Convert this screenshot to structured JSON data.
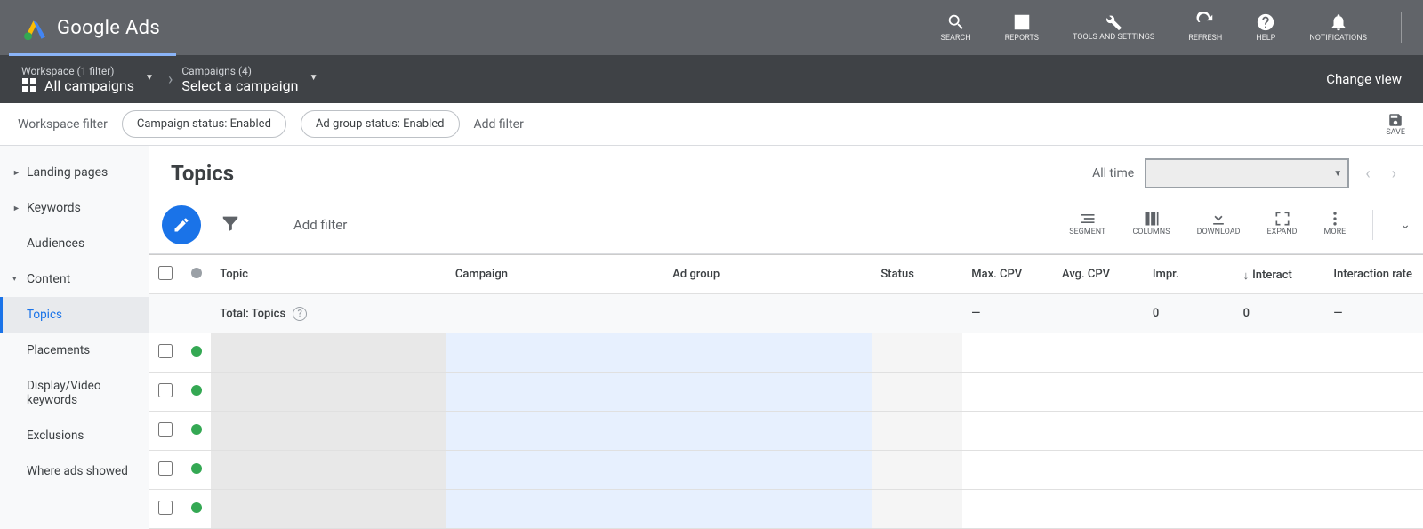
{
  "brand": "Google Ads",
  "topActions": [
    {
      "label": "SEARCH"
    },
    {
      "label": "REPORTS"
    },
    {
      "label": "TOOLS AND SETTINGS"
    },
    {
      "label": "REFRESH"
    },
    {
      "label": "HELP"
    },
    {
      "label": "NOTIFICATIONS"
    }
  ],
  "nav": {
    "workspace": {
      "small": "Workspace (1 filter)",
      "big": "All campaigns"
    },
    "campaigns": {
      "small": "Campaigns (4)",
      "big": "Select a campaign"
    },
    "changeView": "Change view"
  },
  "filterBar": {
    "title": "Workspace filter",
    "chips": [
      "Campaign status: Enabled",
      "Ad group status: Enabled"
    ],
    "addFilter": "Add filter",
    "save": "SAVE"
  },
  "sidebar": {
    "items": [
      {
        "label": "Landing pages",
        "caret": "►"
      },
      {
        "label": "Keywords",
        "caret": "►"
      },
      {
        "label": "Audiences",
        "caret": ""
      },
      {
        "label": "Content",
        "caret": "▾"
      }
    ],
    "subs": [
      {
        "label": "Topics",
        "active": true
      },
      {
        "label": "Placements"
      },
      {
        "label": "Display/Video keywords"
      },
      {
        "label": "Exclusions"
      },
      {
        "label": "Where ads showed"
      }
    ]
  },
  "page": {
    "title": "Topics",
    "allTime": "All time"
  },
  "toolbar": {
    "addFilter": "Add filter",
    "buttons": [
      "SEGMENT",
      "COLUMNS",
      "DOWNLOAD",
      "EXPAND",
      "MORE"
    ]
  },
  "table": {
    "headers": {
      "topic": "Topic",
      "campaign": "Campaign",
      "adgroup": "Ad group",
      "status": "Status",
      "maxcpv": "Max. CPV",
      "avgcpv": "Avg. CPV",
      "impr": "Impr.",
      "interact": "Interact",
      "interactionRate": "Interaction rate"
    },
    "total": {
      "label": "Total: Topics",
      "maxcpv": "—",
      "impr": "0",
      "interact": "0",
      "rate": "—"
    },
    "rowCount": 5
  }
}
